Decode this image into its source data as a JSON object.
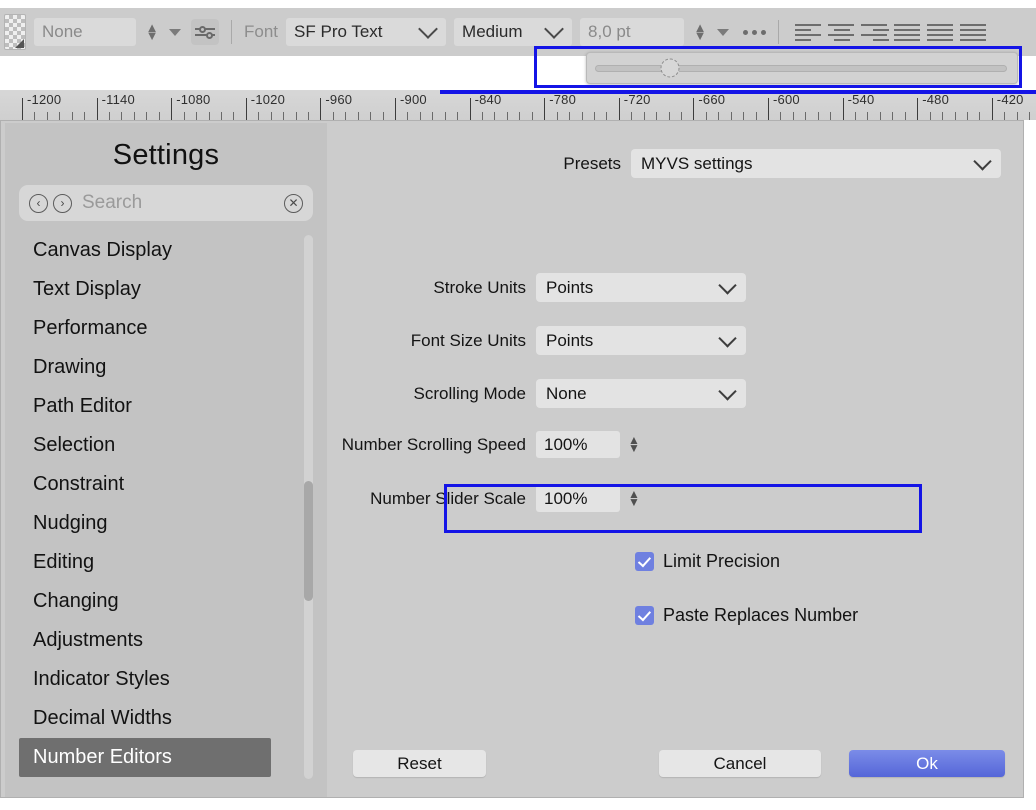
{
  "toolbar": {
    "swatch_name": "transparency-swatch",
    "style_value": "None",
    "font_label": "Font",
    "font_family_value": "SF Pro Text",
    "font_weight_value": "Medium",
    "font_size_value": "8,0 pt",
    "more_label": "•••",
    "align_icons": [
      "align-left-icon",
      "align-center-icon",
      "align-right-icon",
      "align-justify-icon",
      "align-justify-all-icon",
      "align-justify-last-icon"
    ]
  },
  "slider_popup": {
    "name": "font-size-slider-popup",
    "thumb_position_percent": 18,
    "highlight_color": "#1414e6"
  },
  "ruler": {
    "unit_step": 60,
    "labels": [
      "-1200",
      "-1140",
      "-1080",
      "-1020",
      "-960",
      "-900",
      "-840",
      "-780",
      "-720",
      "-660",
      "-600",
      "-540",
      "-480",
      "-420"
    ],
    "highlight_color": "#1414e6"
  },
  "sidebar": {
    "title": "Settings",
    "search": {
      "placeholder": "Search",
      "back_glyph": "‹",
      "forward_glyph": "›",
      "clear_glyph": "✕"
    },
    "items": [
      {
        "label": "Canvas Display",
        "selected": false
      },
      {
        "label": "Text Display",
        "selected": false
      },
      {
        "label": "Performance",
        "selected": false
      },
      {
        "label": "Drawing",
        "selected": false
      },
      {
        "label": "Path Editor",
        "selected": false
      },
      {
        "label": "Selection",
        "selected": false
      },
      {
        "label": "Constraint",
        "selected": false
      },
      {
        "label": "Nudging",
        "selected": false
      },
      {
        "label": "Editing",
        "selected": false
      },
      {
        "label": "Changing",
        "selected": false
      },
      {
        "label": "Adjustments",
        "selected": false
      },
      {
        "label": "Indicator Styles",
        "selected": false
      },
      {
        "label": "Decimal Widths",
        "selected": false
      },
      {
        "label": "Number Editors",
        "selected": true
      }
    ],
    "selected_bg": "#6f6f6f"
  },
  "pane": {
    "presets": {
      "label": "Presets",
      "value": "MYVS settings"
    },
    "fields": [
      {
        "label": "Stroke Units",
        "value": "Points",
        "type": "select"
      },
      {
        "label": "Font Size Units",
        "value": "Points",
        "type": "select"
      },
      {
        "label": "Scrolling Mode",
        "value": "None",
        "type": "select",
        "highlighted": true
      }
    ],
    "steppers": [
      {
        "label": "Number Scrolling Speed",
        "value": "100%"
      },
      {
        "label": "Number Slider Scale",
        "value": "100%"
      }
    ],
    "checkboxes": [
      {
        "label": "Limit Precision",
        "checked": true
      },
      {
        "label": "Paste Replaces Number",
        "checked": true
      }
    ],
    "checkbox_color": "#6f80e0"
  },
  "buttons": {
    "reset": "Reset",
    "cancel": "Cancel",
    "ok": "Ok",
    "ok_color": "#5566d8"
  }
}
